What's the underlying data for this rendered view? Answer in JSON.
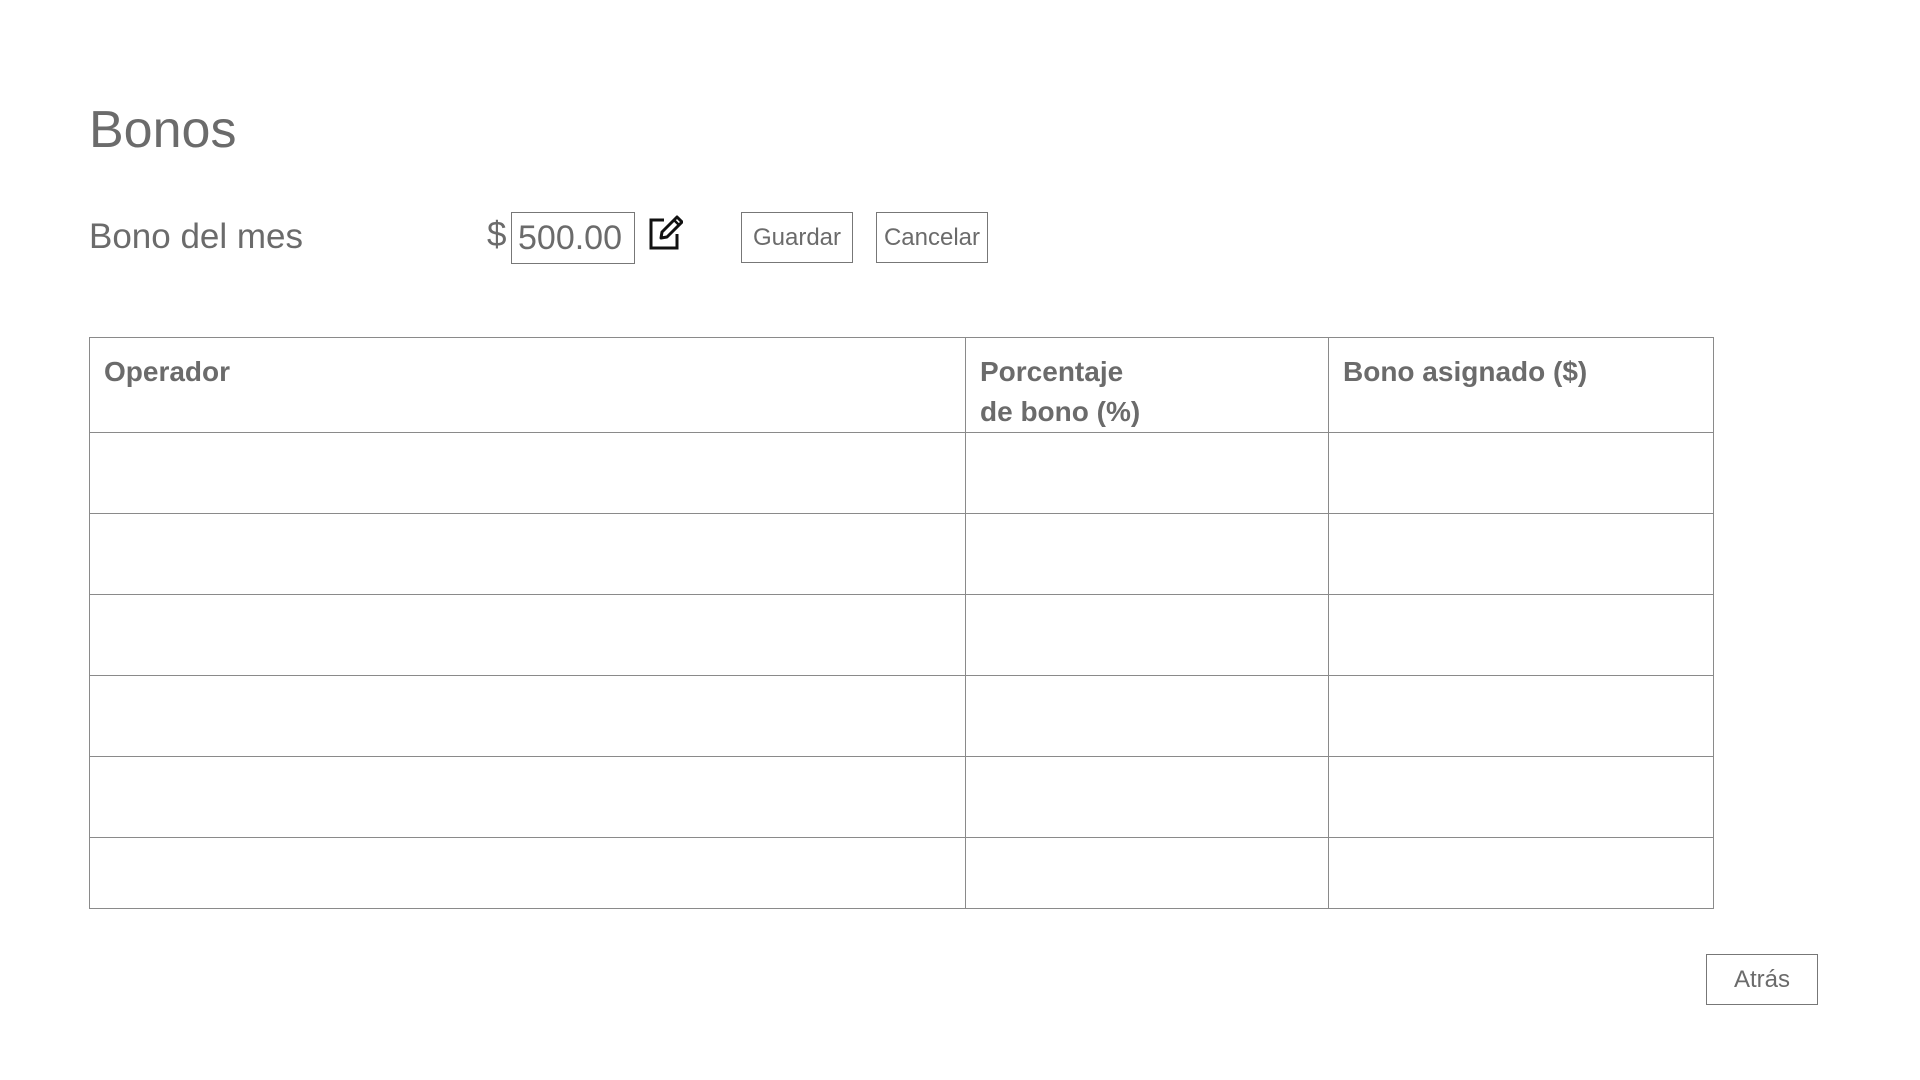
{
  "page": {
    "title": "Bonos"
  },
  "bonus_month": {
    "label": "Bono del mes",
    "currency_symbol": "$",
    "value": "500.00",
    "edit_icon": "edit-pencil-icon"
  },
  "actions": {
    "save_label": "Guardar",
    "cancel_label": "Cancelar",
    "back_label": "Atrás"
  },
  "table": {
    "columns": [
      "Operador",
      "Porcentaje\nde bono (%)",
      "Bono asignado ($)"
    ],
    "rows": [
      [
        "",
        "",
        ""
      ],
      [
        "",
        "",
        ""
      ],
      [
        "",
        "",
        ""
      ],
      [
        "",
        "",
        ""
      ],
      [
        "",
        "",
        ""
      ],
      [
        "",
        "",
        ""
      ]
    ]
  },
  "colors": {
    "text": "#6b6b6b",
    "border": "#8a8a8a",
    "background": "#ffffff"
  }
}
